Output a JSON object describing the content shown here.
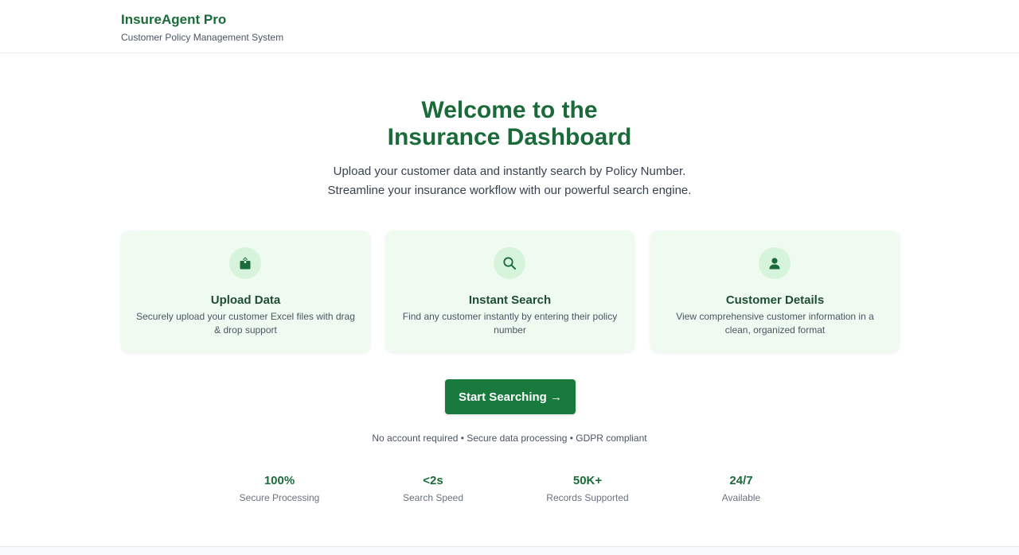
{
  "header": {
    "title": "InsureAgent Pro",
    "subtitle": "Customer Policy Management System"
  },
  "hero": {
    "title_line1": "Welcome to the",
    "title_line2": "Insurance Dashboard",
    "desc_line1": "Upload your customer data and instantly search by Policy Number.",
    "desc_line2": "Streamline your insurance workflow with our powerful search engine."
  },
  "features": [
    {
      "icon": "upload-icon",
      "title": "Upload Data",
      "desc": "Securely upload your customer Excel files with drag & drop support"
    },
    {
      "icon": "search-icon",
      "title": "Instant Search",
      "desc": "Find any customer instantly by entering their policy number"
    },
    {
      "icon": "user-icon",
      "title": "Customer Details",
      "desc": "View comprehensive customer information in a clean, organized format"
    }
  ],
  "cta": {
    "label": "Start Searching →"
  },
  "note": "No account required • Secure data processing • GDPR compliant",
  "stats": [
    {
      "value": "100%",
      "label": "Secure Processing"
    },
    {
      "value": "<2s",
      "label": "Search Speed"
    },
    {
      "value": "50K+",
      "label": "Records Supported"
    },
    {
      "value": "24/7",
      "label": "Available"
    }
  ],
  "colors": {
    "brand": "#1a6b39",
    "button": "#187a3c",
    "card_bg": "#effbf1",
    "icon_bg": "#d6f3dc"
  }
}
